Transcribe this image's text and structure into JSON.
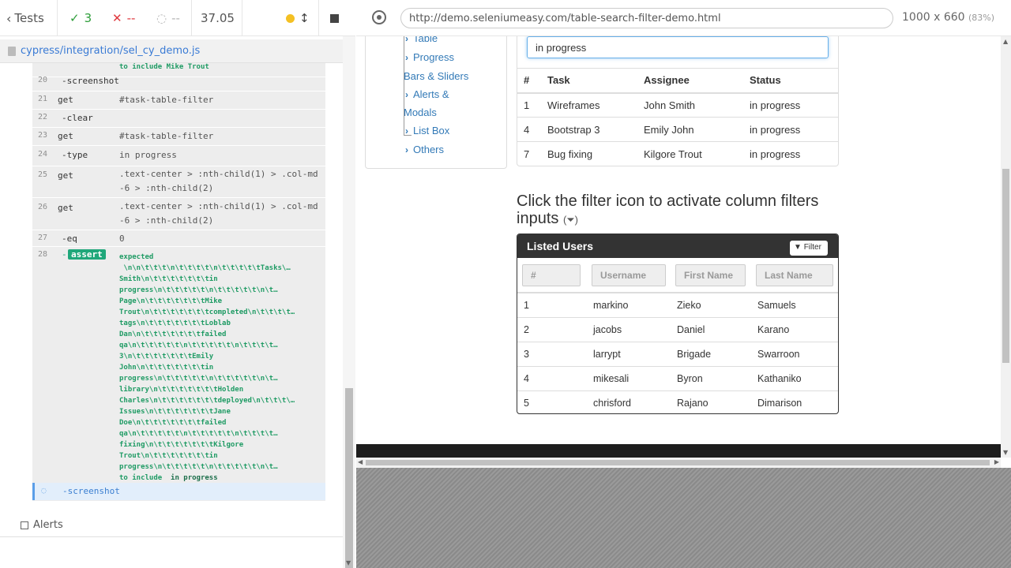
{
  "reporter": {
    "back_label": "Tests",
    "passed": "3",
    "failed": "--",
    "pending": "--",
    "duration": "37.05"
  },
  "spec_file": "cypress/integration/sel_cy_demo.js",
  "commands": [
    {
      "num": "",
      "name": "",
      "msg": "to include  Mike Trout"
    },
    {
      "num": "20",
      "name": "-screenshot",
      "msg": ""
    },
    {
      "num": "21",
      "name": "get",
      "msg": "#task-table-filter"
    },
    {
      "num": "22",
      "name": "-clear",
      "msg": ""
    },
    {
      "num": "23",
      "name": "get",
      "msg": "#task-table-filter"
    },
    {
      "num": "24",
      "name": "-type",
      "msg": "in progress"
    },
    {
      "num": "25",
      "name": "get",
      "msg": ".text-center > :nth-child(1) > .col-md-6 > :nth-child(2)"
    },
    {
      "num": "26",
      "name": "get",
      "msg": ".text-center > :nth-child(1) > .col-md-6 > :nth-child(2)"
    },
    {
      "num": "27",
      "name": "-eq",
      "msg": "0"
    },
    {
      "num": "28",
      "name": "assert",
      "msg": ""
    }
  ],
  "assert_lines": [
    "expected",
    " \\n\\n\\t\\t\\t\\n\\t\\t\\t\\t\\n\\t\\t\\t\\t\\tTasks\\…",
    "Smith\\n\\t\\t\\t\\t\\t\\t\\tin",
    "progress\\n\\t\\t\\t\\t\\t\\n\\t\\t\\t\\t\\t\\n\\t…",
    "Page\\n\\t\\t\\t\\t\\t\\t\\tMike",
    "Trout\\n\\t\\t\\t\\t\\t\\t\\tcompleted\\n\\t\\t\\t\\t…",
    "tags\\n\\t\\t\\t\\t\\t\\t\\tLoblab",
    "Dan\\n\\t\\t\\t\\t\\t\\t\\tfailed",
    "qa\\n\\t\\t\\t\\t\\t\\n\\t\\t\\t\\t\\t\\n\\t\\t\\t\\t…",
    "3\\n\\t\\t\\t\\t\\t\\t\\tEmily",
    "John\\n\\t\\t\\t\\t\\t\\t\\tin",
    "progress\\n\\t\\t\\t\\t\\t\\n\\t\\t\\t\\t\\t\\n\\t…",
    "library\\n\\t\\t\\t\\t\\t\\t\\tHolden",
    "Charles\\n\\t\\t\\t\\t\\t\\t\\tdeployed\\n\\t\\t\\t\\…",
    "Issues\\n\\t\\t\\t\\t\\t\\t\\tJane",
    "Doe\\n\\t\\t\\t\\t\\t\\t\\tfailed",
    "qa\\n\\t\\t\\t\\t\\t\\n\\t\\t\\t\\t\\t\\n\\t\\t\\t\\t…",
    "fixing\\n\\t\\t\\t\\t\\t\\t\\tKilgore",
    "Trout\\n\\t\\t\\t\\t\\t\\t\\tin",
    "progress\\n\\t\\t\\t\\t\\t\\n\\t\\t\\t\\t\\t\\n\\t…"
  ],
  "assert_tail": {
    "prefix": "to include",
    "value": "in progress"
  },
  "running_cmd": "-screenshot",
  "alerts_label": "Alerts",
  "browser": {
    "url": "http://demo.seleniumeasy.com/table-search-filter-demo.html",
    "viewport_size": "1000 x 660",
    "zoom": "(83%)"
  },
  "sidenav": {
    "items": [
      "Table",
      "Progress",
      "Bars & Sliders",
      "Alerts &",
      "Modals",
      "List Box",
      "Others"
    ]
  },
  "task_filter_value": "in progress",
  "task_table": {
    "headers": [
      "#",
      "Task",
      "Assignee",
      "Status"
    ],
    "rows": [
      [
        "1",
        "Wireframes",
        "John Smith",
        "in progress"
      ],
      [
        "4",
        "Bootstrap 3",
        "Emily John",
        "in progress"
      ],
      [
        "7",
        "Bug fixing",
        "Kilgore Trout",
        "in progress"
      ]
    ]
  },
  "filter_heading": "Click the filter icon to activate column filters inputs",
  "users_panel": {
    "title": "Listed Users",
    "filter_btn": "Filter",
    "placeholders": [
      "#",
      "Username",
      "First Name",
      "Last Name"
    ],
    "rows": [
      [
        "1",
        "markino",
        "Zieko",
        "Samuels"
      ],
      [
        "2",
        "jacobs",
        "Daniel",
        "Karano"
      ],
      [
        "3",
        "larrypt",
        "Brigade",
        "Swarroon"
      ],
      [
        "4",
        "mikesali",
        "Byron",
        "Kathaniko"
      ],
      [
        "5",
        "chrisford",
        "Rajano",
        "Dimarison"
      ]
    ]
  },
  "colors": {
    "pass": "#2e9e3a",
    "fail": "#e0383e",
    "badge": "#1fa77a",
    "link": "#337ab7"
  }
}
